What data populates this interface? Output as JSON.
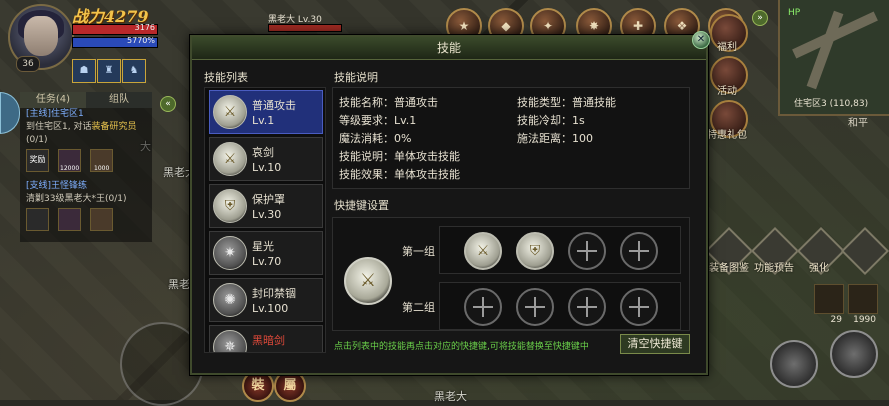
{
  "hud": {
    "power_label": "战力4279",
    "level": "36",
    "hp_text": "3176",
    "mp_text": "5770%",
    "buffs": [
      "",
      "",
      ""
    ]
  },
  "quest": {
    "tab_quest": "任务(4)",
    "tab_team": "组队",
    "main_title": "[主线]住宅区1",
    "main_body_pre": "到住宅区1, 对话",
    "main_body_hl": "装备研究员",
    "main_body_post": "(0/1)",
    "reward_1_label": "奖励",
    "reward_2": "12000",
    "reward_3": "1000",
    "branch_title": "[支线]王怪锋练",
    "branch_body": "清剿33级黑老大*王(0/1)"
  },
  "target": {
    "name": "黑老大 Lv.30"
  },
  "world_names": [
    "黑老大",
    "黑老大",
    "黑老大",
    "大"
  ],
  "right_panel": {
    "minimap_label": "住宅区3 (110,83)",
    "minimap_hp": "HP",
    "labels": [
      "福利",
      "活动",
      "特惠礼包",
      "装备图鉴",
      "功能预告",
      "强化"
    ],
    "peace": "和平",
    "bag_counts": [
      "29",
      "1990"
    ]
  },
  "bottom_buttons": [
    "裝",
    "屬"
  ],
  "dialog": {
    "title": "技能",
    "list_title": "技能列表",
    "info_title": "技能说明",
    "shortcut_title": "快捷键设置",
    "skills": [
      {
        "name": "普通攻击",
        "level": "Lv.1"
      },
      {
        "name": "哀剑",
        "level": "Lv.10"
      },
      {
        "name": "保护罩",
        "level": "Lv.30"
      },
      {
        "name": "星光",
        "level": "Lv.70"
      },
      {
        "name": "封印禁锢",
        "level": "Lv.100"
      },
      {
        "name": "黑暗剑",
        "level": ""
      }
    ],
    "info": {
      "name": "技能名称：普通攻击",
      "level_req": "等级要求：Lv.1",
      "mana": "魔法消耗：0%",
      "desc": "技能说明：单体攻击技能",
      "effect": "技能效果：单体攻击技能",
      "type": "技能类型：普通技能",
      "cooldown": "技能冷却：1s",
      "range": "施法距离：100"
    },
    "group1_label": "第一组",
    "group2_label": "第二组",
    "hint": "点击列表中的技能再点击对应的快捷键,可将技能替换至快捷键中",
    "clear_button": "清空快捷键"
  },
  "colors": {
    "accent_green": "#6ad04a",
    "selected_blue": "#21307a",
    "gold": "#f2c34a"
  }
}
